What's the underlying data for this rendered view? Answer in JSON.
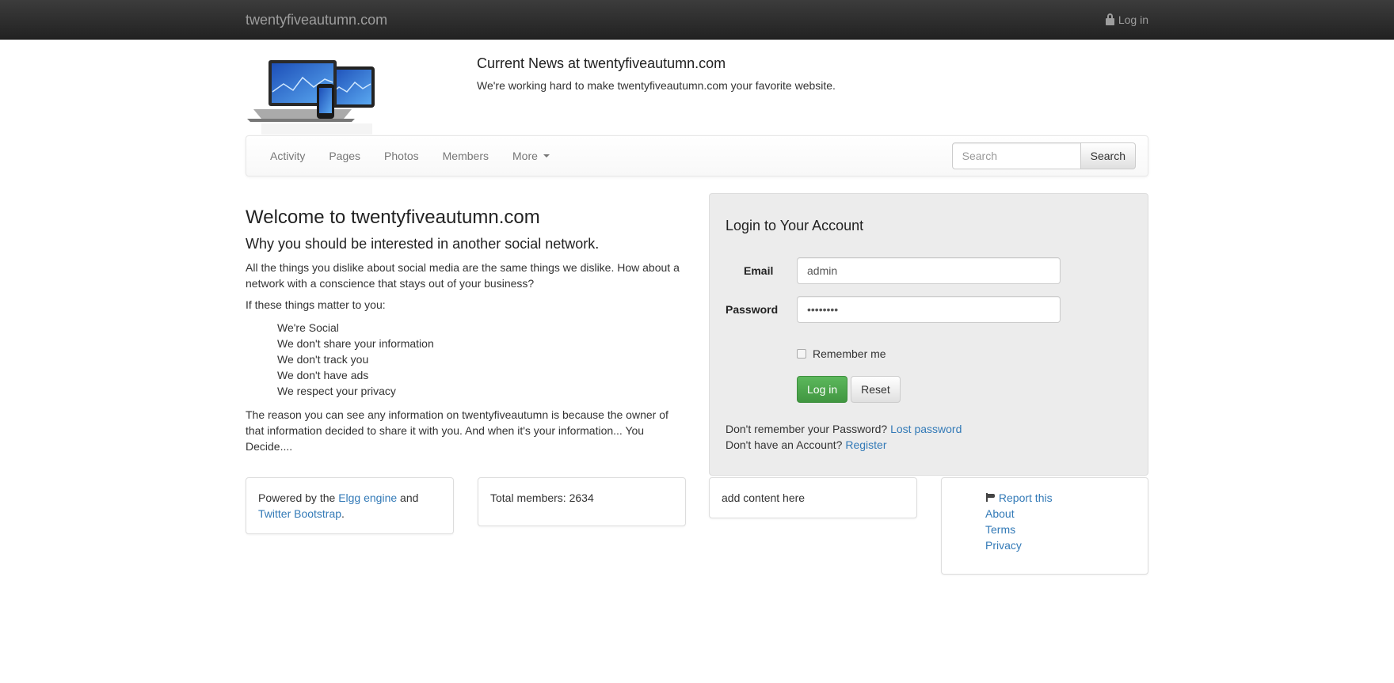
{
  "topbar": {
    "brand": "twentyfiveautumn.com",
    "login_label": "Log in"
  },
  "header": {
    "news_title": "Current News at twentyfiveautumn.com",
    "news_text": "We're working hard to make twentyfiveautumn.com your favorite website."
  },
  "nav": {
    "items": [
      {
        "label": "Activity"
      },
      {
        "label": "Pages"
      },
      {
        "label": "Photos"
      },
      {
        "label": "Members"
      },
      {
        "label": "More"
      }
    ],
    "search_placeholder": "Search",
    "search_button": "Search"
  },
  "welcome": {
    "title": "Welcome to twentyfiveautumn.com",
    "subtitle": "Why you should be interested in another social network.",
    "intro": "All the things you dislike about social media are the same things we dislike. How about a network with a conscience that stays out of your business?",
    "lead": "If these things matter to you:",
    "points": [
      "We're Social",
      "We don't share your information",
      "We don't track you",
      "We don't have ads",
      "We respect your privacy"
    ],
    "closing": "The reason you can see any information on twentyfiveautumn is because the owner of that information decided to share it with you. And when it's your information... You Decide...."
  },
  "login": {
    "title": "Login to Your Account",
    "email_label": "Email",
    "email_value": "admin",
    "password_label": "Password",
    "password_value": "password",
    "remember_label": "Remember me",
    "remember_checked": false,
    "login_button": "Log in",
    "reset_button": "Reset",
    "forgot_text": "Don't remember your Password?",
    "forgot_link": "Lost password",
    "register_text": "Don't have an Account?",
    "register_link": "Register"
  },
  "footer": {
    "powered_prefix": "Powered by the",
    "elgg_link": "Elgg engine",
    "and_text": "and",
    "bootstrap_link": "Twitter Bootstrap",
    "period": ".",
    "total_members": "Total members: 2634",
    "placeholder": "add content here",
    "links": {
      "report": "Report this",
      "about": "About",
      "terms": "Terms",
      "privacy": "Privacy"
    }
  },
  "colors": {
    "topbar": "#222222",
    "link": "#337ab7",
    "login_button": "#5cb85c",
    "panel": "#ececec"
  }
}
